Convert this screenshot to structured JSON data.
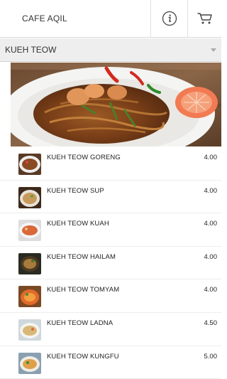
{
  "header": {
    "title": "CAFE AQIL",
    "info_icon": "info-circle-icon",
    "cart_icon": "cart-icon"
  },
  "category": {
    "selected": "KUEH TEOW",
    "dropdown_icon": "caret-down-icon"
  },
  "hero": {
    "image_icon": "kueh-teow-dish-photo"
  },
  "menu": {
    "items": [
      {
        "name": "KUEH TEOW GORENG",
        "price": "4.00"
      },
      {
        "name": "KUEH TEOW SUP",
        "price": "4.00"
      },
      {
        "name": "KUEH TEOW KUAH",
        "price": "4.00"
      },
      {
        "name": "KUEH TEOW HAILAM",
        "price": "4.00"
      },
      {
        "name": "KUEH TEOW TOMYAM",
        "price": "4.00"
      },
      {
        "name": "KUEH TEOW LADNA",
        "price": "4.50"
      },
      {
        "name": "KUEH TEOW KUNGFU",
        "price": "5.00"
      }
    ]
  },
  "colors": {
    "header_bg": "#ffffff",
    "category_bg": "#eeeeee",
    "text": "#222222",
    "divider": "#ededed"
  }
}
